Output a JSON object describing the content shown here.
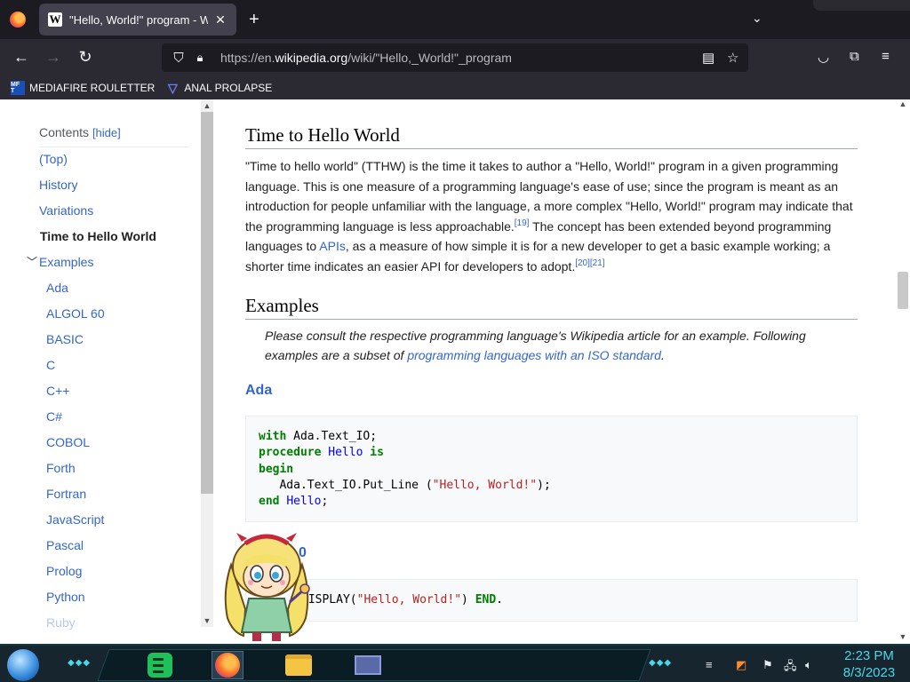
{
  "tab": {
    "title": "\"Hello, World!\" program - Wikipedia",
    "favicon": "W",
    "close": "✕"
  },
  "newtab": "+",
  "tablist": "⌄",
  "nav": {
    "back": "←",
    "forward": "→",
    "reload": "↻"
  },
  "url": {
    "prefix": "https://en.",
    "domain": "wikipedia.org",
    "path": "/wiki/\"Hello,_World!\"_program"
  },
  "bookmarks": [
    {
      "label": "MEDIAFIRE ROULETTER",
      "icon": "MF T"
    },
    {
      "label": "ANAL PROLAPSE",
      "icon": "▽"
    }
  ],
  "toc": {
    "title": "Contents",
    "hide_label": "[hide]",
    "items": [
      {
        "label": "(Top)"
      },
      {
        "label": "History"
      },
      {
        "label": "Variations"
      },
      {
        "label": "Time to Hello World"
      },
      {
        "label": "Examples"
      },
      {
        "label": "Ada"
      },
      {
        "label": "ALGOL 60"
      },
      {
        "label": "BASIC"
      },
      {
        "label": "C"
      },
      {
        "label": "C++"
      },
      {
        "label": "C#"
      },
      {
        "label": "COBOL"
      },
      {
        "label": "Forth"
      },
      {
        "label": "Fortran"
      },
      {
        "label": "JavaScript"
      },
      {
        "label": "Pascal"
      },
      {
        "label": "Prolog"
      },
      {
        "label": "Python"
      },
      {
        "label": "Ruby"
      }
    ]
  },
  "article": {
    "section1_title": "Time to Hello World",
    "p1_a": "\"Time to hello world\" (TTHW) is the time it takes to author a \"Hello, World!\" program in a given programming language. This is one measure of a programming language's ease of use; since the program is meant as an introduction for people unfamiliar with the language, a more complex \"Hello, World!\" program may indicate that the programming language is less approachable.",
    "ref19": "[19]",
    "p1_b": " The concept has been extended beyond programming languages to ",
    "apis": "APIs",
    "p1_c": ", as a measure of how simple it is for a new developer to get a basic example working; a shorter time indicates an easier API for developers to adopt.",
    "ref20": "[20]",
    "ref21": "[21]",
    "section2_title": "Examples",
    "hat_a": "Please consult the respective programming language's Wikipedia article for an example. Following examples are a subset of ",
    "hat_link": "programming languages with an ISO standard",
    "hat_b": ".",
    "ada_title": "Ada",
    "ada_code": {
      "with_kw": "with",
      "with_rest": " Ada.Text_IO;",
      "proc_kw": "procedure",
      "proc_name": "Hello",
      "is_kw": "is",
      "begin_kw": "begin",
      "put_a": "   Ada.Text_IO.Put_Line (",
      "put_str": "\"Hello, World!\"",
      "put_b": ");",
      "end_kw": "end",
      "end_name": "Hello",
      "end_semi": ";"
    },
    "algol_title_tail": "0",
    "algol_line_a": "DISPLAY(",
    "algol_str": "\"Hello, World!\"",
    "algol_b": ") ",
    "algol_end": "END",
    "algol_dot": "."
  },
  "clock": {
    "time": "2:23 PM",
    "date": "8/3/2023"
  },
  "colors": {
    "link": "#3366cc",
    "keyword": "#008000",
    "string": "#ba2121",
    "clock": "#4ad7e8"
  }
}
